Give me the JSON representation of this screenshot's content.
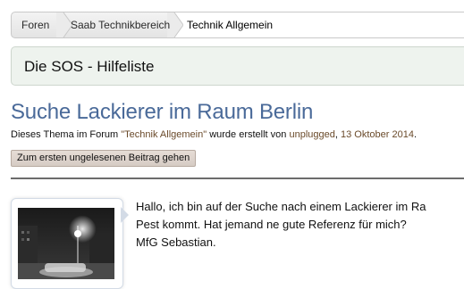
{
  "breadcrumb": {
    "items": [
      {
        "label": "Foren"
      },
      {
        "label": "Saab Technikbereich"
      },
      {
        "label": "Technik Allgemein"
      }
    ]
  },
  "section": {
    "title": "Die SOS - Hilfeliste"
  },
  "thread": {
    "title": "Suche Lackierer im Raum Berlin",
    "meta_prefix": "Dieses Thema im Forum ",
    "forum": "\"Technik Allgemein\"",
    "meta_mid": " wurde erstellt von ",
    "user": "unplugged",
    "meta_sep": ", ",
    "date": "13 Oktober 2014",
    "meta_end": "."
  },
  "buttons": {
    "unread": "Zum ersten ungelesenen Beitrag gehen"
  },
  "post": {
    "lines": [
      "Hallo, ich bin auf der Suche nach einem Lackierer im Ra",
      "Pest kommt. Hat jemand ne gute Referenz für mich?",
      "MfG Sebastian."
    ]
  }
}
